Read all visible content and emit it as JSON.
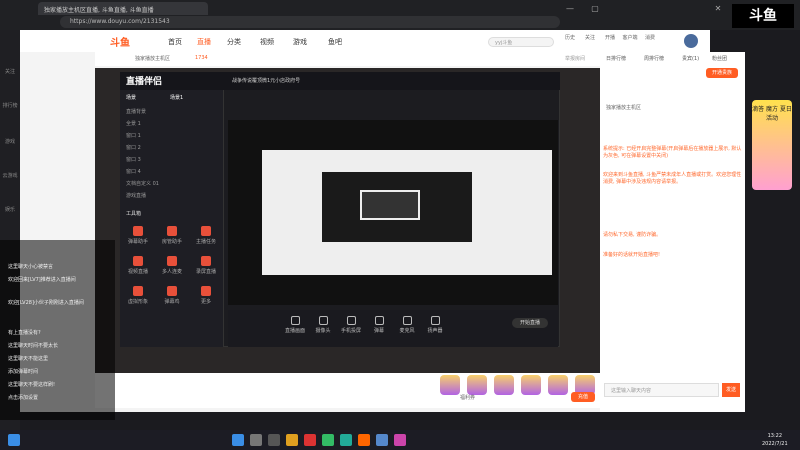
{
  "browser": {
    "tab_title": "独家播放主机区直播, 斗鱼直播, 斗鱼直播",
    "url": "https://www.douyu.com/2131543",
    "corner_logo": "斗鱼"
  },
  "rail": [
    "关注",
    "排行榜",
    "游戏",
    "云游戏",
    "娱乐"
  ],
  "header": {
    "logo": "斗鱼",
    "nav": [
      "首页",
      "直播",
      "分类",
      "视频",
      "游戏",
      "鱼吧"
    ],
    "active_nav": "直播",
    "search_placeholder": "yyj斗鱼",
    "icons": [
      "历史",
      "关注",
      "开播",
      "客户端",
      "消费",
      "登录"
    ]
  },
  "room": {
    "category": "独家播放主机区",
    "hot": "1734",
    "report": "举报房间"
  },
  "obs": {
    "app_name": "直播伴侣",
    "scene_tabs": [
      "场景",
      "场景1"
    ],
    "scenes": [
      "直播背景",
      "全景 1",
      "窗口 1",
      "窗口 2",
      "窗口 3",
      "窗口 4",
      "文档自定义 01",
      "游戏直播"
    ],
    "tools_title": "工具箱",
    "tools": [
      "弹幕助手",
      "房管助手",
      "主播任务",
      "视频直播",
      "多人连麦",
      "录屏直播",
      "虚拟形象",
      "弹幕鸡",
      "更多"
    ],
    "title": "战争传说覆顶微1元小店政府号",
    "bottom_tools": [
      "直播画面",
      "摄像头",
      "手机投屏",
      "弹幕",
      "麦克风",
      "扬声器"
    ],
    "start_label": "开始直播"
  },
  "gifts_label": "福利券",
  "recharge": "充值",
  "chat": [
    "这里聊天小心被禁言",
    "欢迎回来[LV7]推荐进入直播间",
    "欢迎[LV28]小伙子刚刚进入直播间",
    "有上直播没有?",
    "这里聊天时间不要太长",
    "这里聊天不能这里",
    "添加弹幕时间",
    "这里聊天不要这样刷!",
    "点击添加设置"
  ],
  "right_panel": {
    "tabs": [
      "日排行榜",
      "周排行榜",
      "贵宾(1)",
      "粉丝团"
    ],
    "follow": "开通贵族",
    "room_name": "独家播放主机区",
    "system_messages": [
      "系统提示: 已经开启完整弹幕(开启弹幕后在播放器上展示, 默认为灰色, 可在弹幕设置中关闭)",
      "欢迎来到斗鱼直播, 斗鱼严禁未成年人直播或打赏。欢迎您理性消费, 弹幕中涉及违规内容请举报。",
      "请勿私下交易, 谨防诈骗。",
      "准备好的话就开始直播吧!"
    ],
    "input_placeholder": "这里输入聊天内容",
    "send": "发送"
  },
  "ad": "滴答 魔方 夏日活动",
  "taskbar": {
    "time": "13:22",
    "date": "2022/7/21"
  }
}
